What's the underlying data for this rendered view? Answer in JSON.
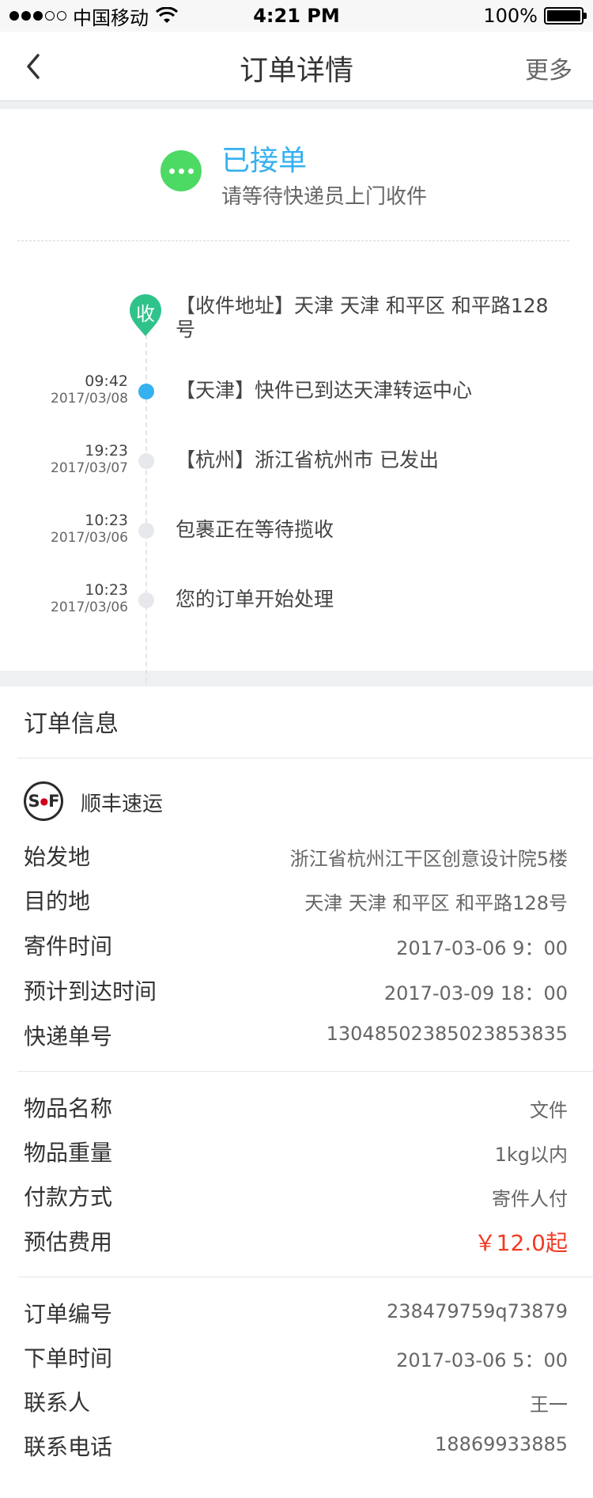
{
  "status_bar": {
    "carrier": "中国移动",
    "time": "4:21 PM",
    "battery": "100%"
  },
  "nav": {
    "title": "订单详情",
    "more": "更多"
  },
  "status": {
    "title": "已接单",
    "subtitle": "请等待快递员上门收件"
  },
  "timeline": {
    "pin_label": "收",
    "address": "【收件地址】天津 天津 和平区 和平路128号",
    "events": [
      {
        "time": "09:42",
        "date": "2017/03/08",
        "text": "【天津】快件已到达天津转运中心",
        "active": true
      },
      {
        "time": "19:23",
        "date": "2017/03/07",
        "text": "【杭州】浙江省杭州市 已发出",
        "active": false
      },
      {
        "time": "10:23",
        "date": "2017/03/06",
        "text": "包裹正在等待揽收",
        "active": false
      },
      {
        "time": "10:23",
        "date": "2017/03/06",
        "text": "您的订单开始处理",
        "active": false
      }
    ]
  },
  "order": {
    "heading": "订单信息",
    "carrier": "顺丰速运",
    "carrier_logo": "SF",
    "rows": [
      {
        "label": "始发地",
        "value": "浙江省杭州江干区创意设计院5楼"
      },
      {
        "label": "目的地",
        "value": "天津 天津 和平区 和平路128号"
      },
      {
        "label": "寄件时间",
        "value": "2017-03-06 9：00"
      },
      {
        "label": "预计到达时间",
        "value": "2017-03-09 18：00"
      },
      {
        "label": "快递单号",
        "value": "13048502385023853835"
      },
      {
        "label": "物品名称",
        "value": "文件"
      },
      {
        "label": "物品重量",
        "value": "1kg以内"
      },
      {
        "label": "付款方式",
        "value": "寄件人付"
      },
      {
        "label": "预估费用",
        "value": "￥12.0起"
      },
      {
        "label": "订单编号",
        "value": "238479759q73879"
      },
      {
        "label": "下单时间",
        "value": "2017-03-06 5：00"
      },
      {
        "label": "联系人",
        "value": "王一"
      },
      {
        "label": "联系电话",
        "value": "18869933885"
      }
    ]
  },
  "colors": {
    "accent": "#35b0f0",
    "success": "#4cd964",
    "pin": "#2fc38a",
    "price": "#f23a23"
  }
}
